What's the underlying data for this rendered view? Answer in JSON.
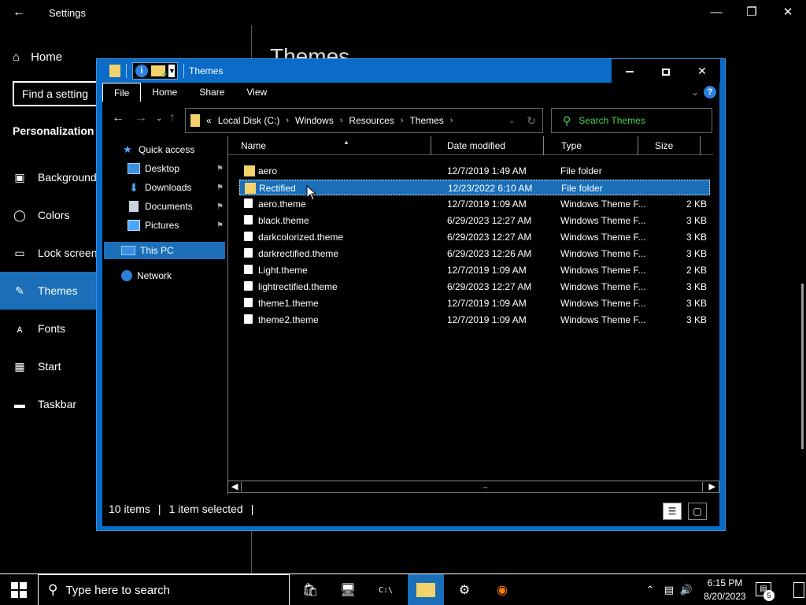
{
  "settings": {
    "title": "Settings",
    "home_label": "Home",
    "find_placeholder": "Find a setting",
    "section": "Personalization",
    "heading": "Themes",
    "nav": [
      {
        "label": "Background",
        "icon": "picture-icon"
      },
      {
        "label": "Colors",
        "icon": "palette-icon"
      },
      {
        "label": "Lock screen",
        "icon": "lock-screen-icon"
      },
      {
        "label": "Themes",
        "icon": "brush-icon",
        "active": true
      },
      {
        "label": "Fonts",
        "icon": "fonts-icon"
      },
      {
        "label": "Start",
        "icon": "start-icon"
      },
      {
        "label": "Taskbar",
        "icon": "taskbar-icon"
      }
    ]
  },
  "explorer": {
    "title": "Themes",
    "ribbon_tabs": [
      "File",
      "Home",
      "Share",
      "View"
    ],
    "breadcrumb": [
      "Local Disk (C:)",
      "Windows",
      "Resources",
      "Themes"
    ],
    "breadcrumb_prefix": "«",
    "search_placeholder": "Search Themes",
    "nav_pane": [
      {
        "label": "Quick access",
        "icon": "star-icon",
        "pinned": false
      },
      {
        "label": "Desktop",
        "icon": "desktop-icon",
        "pinned": true
      },
      {
        "label": "Downloads",
        "icon": "downloads-icon",
        "pinned": true
      },
      {
        "label": "Documents",
        "icon": "documents-icon",
        "pinned": true
      },
      {
        "label": "Pictures",
        "icon": "pictures-icon",
        "pinned": true
      },
      {
        "label": "This PC",
        "icon": "this-pc-icon",
        "selected": true
      },
      {
        "label": "Network",
        "icon": "network-icon"
      }
    ],
    "columns": [
      "Name",
      "Date modified",
      "Type",
      "Size"
    ],
    "files": [
      {
        "name": "aero",
        "date": "12/7/2019 1:49 AM",
        "type": "File folder",
        "size": "",
        "kind": "folder"
      },
      {
        "name": "Rectified",
        "date": "12/23/2022 6:10 AM",
        "type": "File folder",
        "size": "",
        "kind": "folder",
        "selected": true
      },
      {
        "name": "aero.theme",
        "date": "12/7/2019 1:09 AM",
        "type": "Windows Theme F...",
        "size": "2 KB",
        "kind": "file"
      },
      {
        "name": "black.theme",
        "date": "6/29/2023 12:27 AM",
        "type": "Windows Theme F...",
        "size": "3 KB",
        "kind": "file"
      },
      {
        "name": "darkcolorized.theme",
        "date": "6/29/2023 12:27 AM",
        "type": "Windows Theme F...",
        "size": "3 KB",
        "kind": "file"
      },
      {
        "name": "darkrectified.theme",
        "date": "6/29/2023 12:26 AM",
        "type": "Windows Theme F...",
        "size": "3 KB",
        "kind": "file"
      },
      {
        "name": "Light.theme",
        "date": "12/7/2019 1:09 AM",
        "type": "Windows Theme F...",
        "size": "2 KB",
        "kind": "file"
      },
      {
        "name": "lightrectified.theme",
        "date": "6/29/2023 12:27 AM",
        "type": "Windows Theme F...",
        "size": "3 KB",
        "kind": "file"
      },
      {
        "name": "theme1.theme",
        "date": "12/7/2019 1:09 AM",
        "type": "Windows Theme F...",
        "size": "3 KB",
        "kind": "file"
      },
      {
        "name": "theme2.theme",
        "date": "12/7/2019 1:09 AM",
        "type": "Windows Theme F...",
        "size": "3 KB",
        "kind": "file"
      }
    ],
    "status_items": "10 items",
    "status_selected": "1 item selected"
  },
  "taskbar": {
    "search_placeholder": "Type here to search",
    "time": "6:15 PM",
    "date": "8/20/2023",
    "notification_count": "5"
  },
  "colors": {
    "accent": "#1a6fb8",
    "window_border": "#0a6cc8",
    "search_text": "#4cd34c",
    "folder": "#f3d36b"
  }
}
